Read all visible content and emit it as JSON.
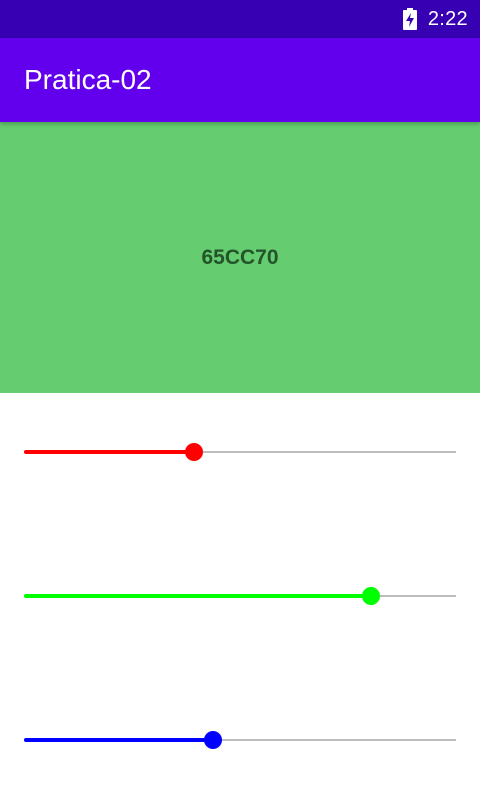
{
  "status_bar": {
    "time": "2:22",
    "battery_icon": "battery-charging-icon"
  },
  "app_bar": {
    "title": "Pratica-02"
  },
  "preview": {
    "hex": "65CC70",
    "background": "#65cc70",
    "text_color": "#23542a"
  },
  "sliders": [
    {
      "name": "red",
      "color": "#ff0000",
      "fraction": 0.394
    },
    {
      "name": "green",
      "color": "#00ff00",
      "fraction": 0.803
    },
    {
      "name": "blue",
      "color": "#0000ff",
      "fraction": 0.438
    }
  ]
}
